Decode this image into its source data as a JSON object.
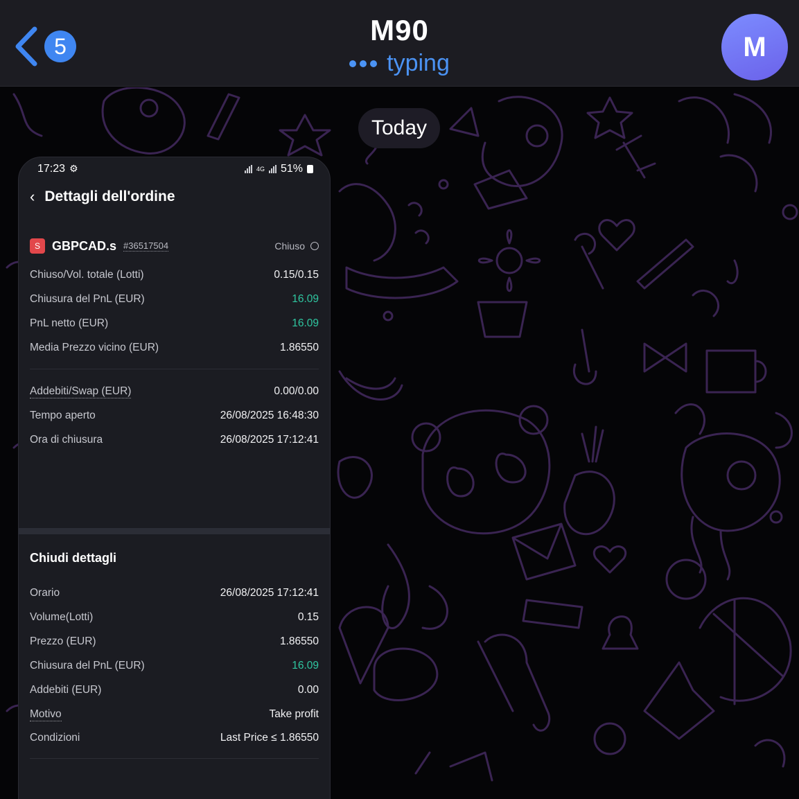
{
  "header": {
    "unread_count": "5",
    "title": "M90",
    "status": "typing",
    "avatar_letter": "M"
  },
  "chat": {
    "date_label": "Today"
  },
  "screenshot": {
    "status_bar": {
      "time": "17:23",
      "network": "4G",
      "battery": "51%"
    },
    "page_title": "Dettagli dell'ordine",
    "order": {
      "symbol_badge": "S",
      "symbol": "GBPCAD.s",
      "order_id": "#36517504",
      "status": "Chiuso"
    },
    "summary": [
      {
        "label": "Chiuso/Vol. totale (Lotti)",
        "value": "0.15/0.15"
      },
      {
        "label": "Chiusura del PnL (EUR)",
        "value": "16.09"
      },
      {
        "label": "PnL netto (EUR)",
        "value": "16.09"
      },
      {
        "label": "Media Prezzo vicino (EUR)",
        "value": "1.86550"
      }
    ],
    "costs": [
      {
        "label": "Addebiti/Swap (EUR)",
        "value": "0.00/0.00"
      },
      {
        "label": "Tempo aperto",
        "value": "26/08/2025 16:48:30"
      },
      {
        "label": "Ora di chiusura",
        "value": "26/08/2025 17:12:41"
      }
    ],
    "close_section_title": "Chiudi dettagli",
    "close_details": [
      {
        "label": "Orario",
        "value": "26/08/2025 17:12:41"
      },
      {
        "label": "Volume(Lotti)",
        "value": "0.15"
      },
      {
        "label": "Prezzo (EUR)",
        "value": "1.86550"
      },
      {
        "label": "Chiusura del PnL (EUR)",
        "value": "16.09"
      },
      {
        "label": "Addebiti (EUR)",
        "value": "0.00"
      },
      {
        "label": "Motivo",
        "value": "Take profit"
      },
      {
        "label": "Condizioni",
        "value": "Last Price ≤ 1.86550"
      }
    ]
  },
  "colors": {
    "accent_blue": "#3f86f1",
    "profit_green": "#2fc6a0",
    "symbol_red": "#e2474b",
    "doodle_purple": "#3a2452"
  }
}
